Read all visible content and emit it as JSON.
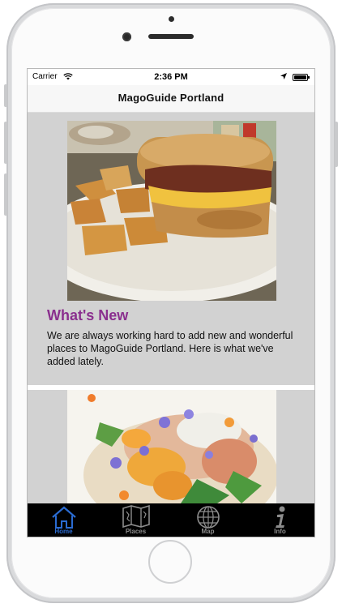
{
  "status_bar": {
    "carrier": "Carrier",
    "time": "2:36 PM"
  },
  "nav": {
    "title": "MagoGuide Portland"
  },
  "cards": [
    {
      "title": "What's New",
      "body": "We are always working hard to add new and wonderful places to MagoGuide Portland. Here is what we've added lately.",
      "image": "breakfast-biscuit-sandwich-photo"
    },
    {
      "image": "plated-dish-with-edible-flowers-photo"
    }
  ],
  "tab_bar": {
    "active": "Home",
    "tabs": [
      {
        "label": "Home",
        "icon": "home-icon"
      },
      {
        "label": "Places",
        "icon": "map-fold-icon"
      },
      {
        "label": "Map",
        "icon": "globe-icon"
      },
      {
        "label": "Info",
        "icon": "info-icon"
      }
    ]
  },
  "colors": {
    "title_purple": "#8a2f8e",
    "active_tab": "#2a6bd1",
    "card_background": "#d2d2d2",
    "tab_bar_background": "#000000"
  }
}
